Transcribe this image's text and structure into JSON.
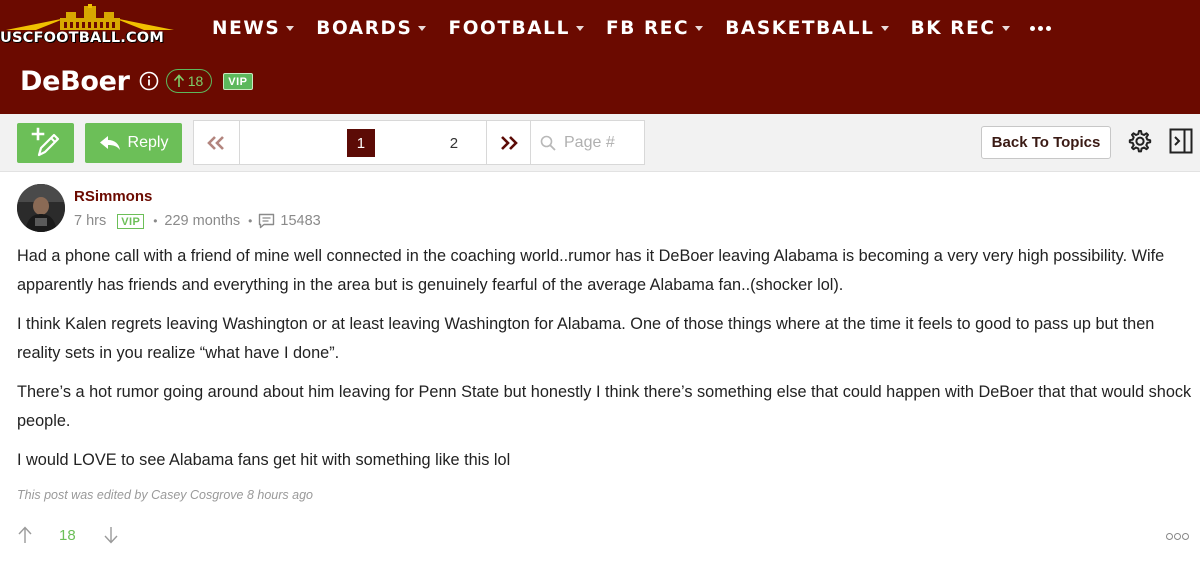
{
  "site": {
    "logo_text": "USCFOOTBALL.COM"
  },
  "nav": {
    "items": [
      {
        "label": "NEWS"
      },
      {
        "label": "BOARDS"
      },
      {
        "label": "FOOTBALL"
      },
      {
        "label": "FB REC"
      },
      {
        "label": "BASKETBALL"
      },
      {
        "label": "BK REC"
      }
    ],
    "more_icon": "more-horizontal-icon"
  },
  "thread": {
    "title": "DeBoer",
    "score": "18",
    "badge": "VIP"
  },
  "toolbar": {
    "new_topic_icon": "new-post-icon",
    "reply_label": "Reply",
    "pages": [
      "1",
      "2"
    ],
    "current_page": "1",
    "page_input_placeholder": "Page #",
    "back_label": "Back To Topics",
    "settings_icon": "gear-icon",
    "panel_icon": "collapse-panel-icon"
  },
  "post": {
    "author": "RSimmons",
    "time": "7 hrs",
    "badge": "VIP",
    "tenure": "229 months",
    "post_count": "15483",
    "paragraphs": [
      "Had a phone call with a friend of mine well connected in the coaching world..rumor has it DeBoer leaving Alabama is becoming a very very high possibility. Wife apparently has friends and everything in the area but is genuinely fearful of the average Alabama fan..(shocker lol).",
      "I think Kalen regrets leaving Washington or at least leaving Washington for Alabama. One of those things where at the time it feels to good to pass up but then reality sets in you realize “what have I done”.",
      "There’s a hot rumor going around about him leaving for Penn State but honestly I think there’s something else that could happen with DeBoer that that would shock people.",
      "I would LOVE to see Alabama fans get hit with something like this lol"
    ],
    "edited_note": "This post was edited by Casey Cosgrove 8 hours ago",
    "vote_count": "18"
  },
  "colors": {
    "header_bg": "#6b0a00",
    "accent_green": "#6cbf58",
    "current_page_bg": "#5c0b06"
  }
}
